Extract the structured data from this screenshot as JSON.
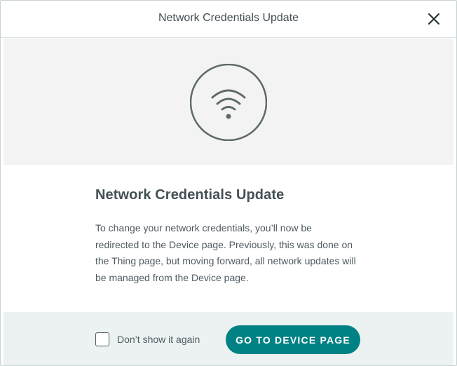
{
  "dialog": {
    "title": "Network Credentials Update",
    "close_icon": "close-icon"
  },
  "hero": {
    "icon": "wifi-icon"
  },
  "content": {
    "heading": "Network Credentials Update",
    "body": "To change your network credentials, you’ll now be redirected to the Device page. Previously, this was done on the Thing page, but moving forward, all network updates will be managed from the Device page."
  },
  "footer": {
    "checkbox_label": "Don’t show it again",
    "checkbox_checked": false,
    "primary_button_label": "GO TO DEVICE PAGE"
  },
  "colors": {
    "accent": "#008184",
    "hero_background": "#f3f3f3",
    "footer_background": "#ecf1f1",
    "icon_stroke": "#5f6a6a"
  }
}
